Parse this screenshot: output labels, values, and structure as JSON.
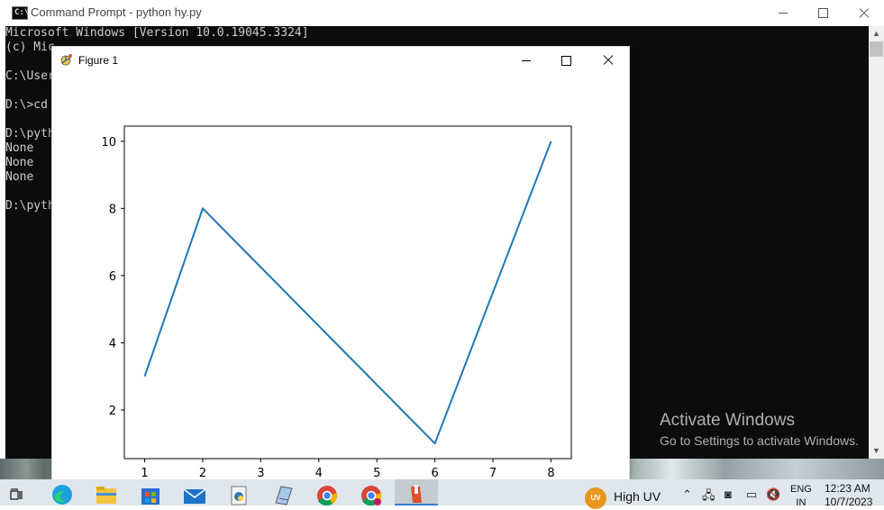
{
  "cmd": {
    "title": "Command Prompt - python  hy.py",
    "console_lines": [
      "Microsoft Windows [Version 10.0.19045.3324]",
      "(c) Mic",
      "",
      "C:\\User",
      "",
      "D:\\>cd",
      "",
      "D:\\pyth",
      "None",
      "None",
      "None",
      "",
      "D:\\pyth"
    ]
  },
  "activation": {
    "title": "Activate Windows",
    "subtitle": "Go to Settings to activate Windows."
  },
  "figure": {
    "title": "Figure 1"
  },
  "chart_data": {
    "type": "line",
    "x": [
      1,
      2,
      6,
      8
    ],
    "y": [
      3,
      8,
      1,
      10
    ],
    "xlim": [
      0.65,
      8.35
    ],
    "ylim": [
      0.55,
      10.45
    ],
    "xticks": [
      1,
      2,
      3,
      4,
      5,
      6,
      7,
      8
    ],
    "yticks": [
      2,
      4,
      6,
      8,
      10
    ],
    "title": "",
    "xlabel": "",
    "ylabel": "",
    "line_color": "#1f77b4",
    "grid": false
  },
  "taskbar": {
    "weather_badge": "UV",
    "weather_text": "High UV",
    "language_top": "ENG",
    "language_bottom": "IN",
    "time": "12:23 AM",
    "date": "10/7/2023"
  },
  "icons": [
    "cmd-icon",
    "figure-app-icon",
    "minimize-icon",
    "maximize-icon",
    "close-icon",
    "task-view-icon",
    "edge-icon",
    "file-explorer-icon",
    "store-icon",
    "mail-icon",
    "python-file-icon",
    "notepad-icon",
    "chrome-icon",
    "chrome-profile-icon",
    "python-app-icon",
    "chevron-up-icon",
    "network-icon",
    "meet-now-icon",
    "monitor-icon",
    "volume-muted-icon"
  ]
}
